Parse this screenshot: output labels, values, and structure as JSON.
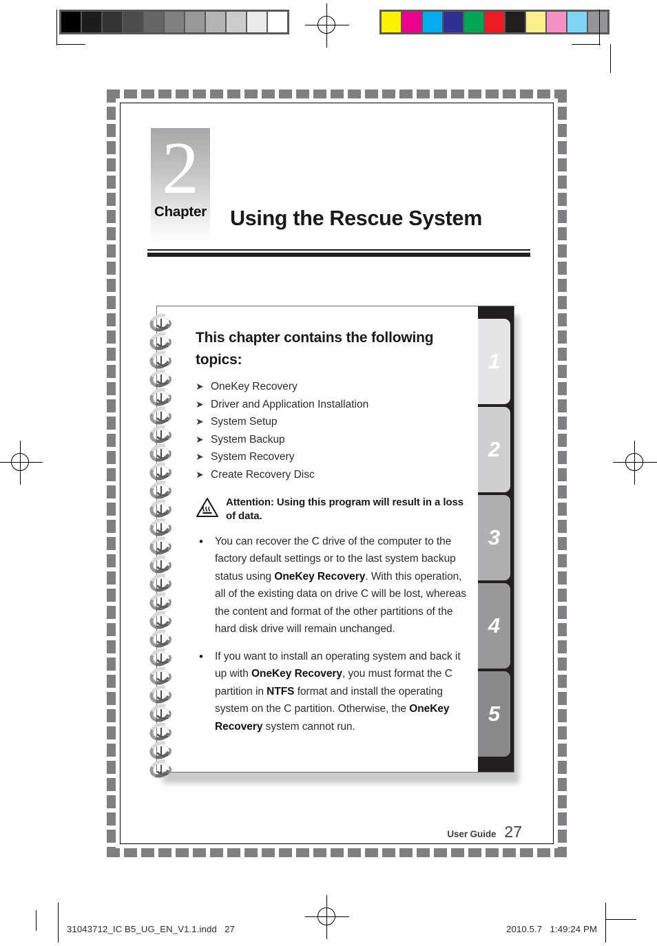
{
  "printer_marks": {
    "grayscale_swatches": [
      "#000000",
      "#1c1c1c",
      "#333333",
      "#4c4c4c",
      "#666666",
      "#808080",
      "#999999",
      "#b3b3b3",
      "#cccccc",
      "#ebebeb",
      "#ffffff"
    ],
    "color_swatches": [
      "#fff200",
      "#ec008c",
      "#00aeef",
      "#2e3192",
      "#00a651",
      "#ed1c24",
      "#231f20",
      "#fbef8b",
      "#f490c3",
      "#7fd4f5",
      "#939598"
    ]
  },
  "chapter": {
    "number": "2",
    "label": "Chapter",
    "title": "Using the Rescue System"
  },
  "panel": {
    "heading": "This chapter contains the following topics:",
    "arrow_glyph": "➤",
    "topics": [
      "OneKey Recovery",
      "Driver and Application Installation",
      "System Setup",
      "System Backup",
      "System Recovery",
      "Create Recovery Disc"
    ],
    "attention": {
      "icon": "hot-surface-warning-icon",
      "text": "Attention: Using this program will result in a loss of data."
    },
    "bullet_glyph": "•",
    "notes": [
      {
        "segments": [
          {
            "text": "You can recover the C drive of the computer to the factory default settings or to the last system backup status using ",
            "bold": false
          },
          {
            "text": "OneKey Recovery",
            "bold": true
          },
          {
            "text": ". With this operation, all of the existing data on drive C will be lost, whereas the content and format of the other partitions of the hard disk drive will remain unchanged.",
            "bold": false
          }
        ]
      },
      {
        "segments": [
          {
            "text": "If you want to install an operating system and back it up with ",
            "bold": false
          },
          {
            "text": "OneKey Recovery",
            "bold": true
          },
          {
            "text": ", you must format the C partition in ",
            "bold": false
          },
          {
            "text": "NTFS",
            "bold": true
          },
          {
            "text": " format and install the operating system on the C partition. Otherwise, the ",
            "bold": false
          },
          {
            "text": "OneKey Recovery",
            "bold": true
          },
          {
            "text": " system cannot run.",
            "bold": false
          }
        ]
      }
    ],
    "tabs": [
      {
        "number": "1",
        "color": "#e6e6e8"
      },
      {
        "number": "2",
        "color": "#cfcfd1"
      },
      {
        "number": "3",
        "color": "#b0b0b2"
      },
      {
        "number": "4",
        "color": "#99999b"
      },
      {
        "number": "5",
        "color": "#8a8a8c"
      }
    ]
  },
  "footer": {
    "label": "User Guide",
    "page": "27"
  },
  "print_info": {
    "filename": "31043712_IC B5_UG_EN_V1.1.indd",
    "page": "27",
    "date": "2010.5.7",
    "time": "1:49:24 PM"
  }
}
